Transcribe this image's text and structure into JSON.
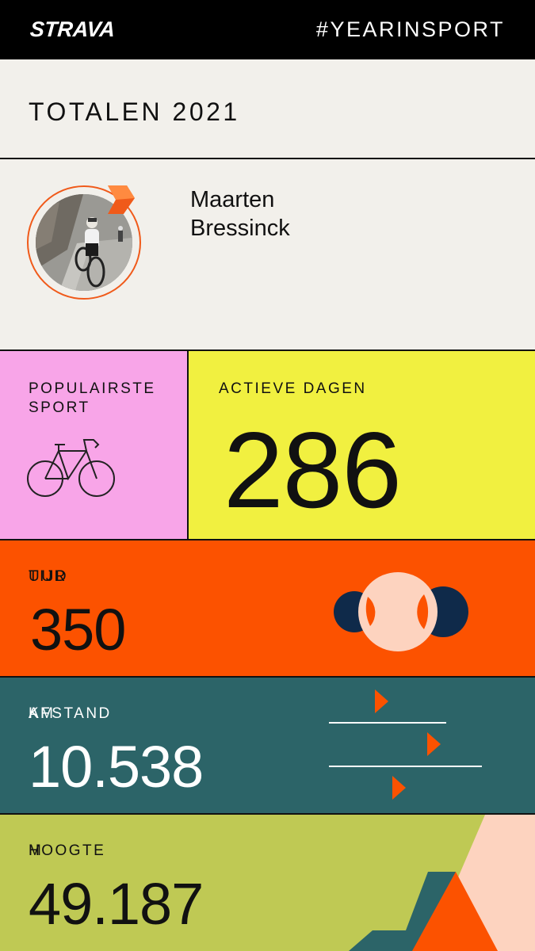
{
  "header": {
    "logo": "STRAVA",
    "hashtag": "#YEARINSPORT"
  },
  "title": "TOTALEN 2021",
  "profile": {
    "first_name": "Maarten",
    "last_name": "Bressinck"
  },
  "popular_sport": {
    "label_line1": "POPULAIRSTE",
    "label_line2": "SPORT",
    "icon": "road-bike-icon"
  },
  "active_days": {
    "label": "ACTIEVE DAGEN",
    "value": "286"
  },
  "time": {
    "label": "TIJD",
    "unit": "UUR",
    "value": "350"
  },
  "distance": {
    "label": "AFSTAND",
    "unit": "KM",
    "value": "10.538"
  },
  "elevation": {
    "label": "HOOGTE",
    "unit": "M",
    "value": "49.187"
  },
  "colors": {
    "header_bg": "#000000",
    "page_bg": "#f2f0eb",
    "sport_bg": "#f8a5e8",
    "days_bg": "#f1f040",
    "time_bg": "#fc5200",
    "distance_bg": "#2c6468",
    "elevation_bg": "#bfc954",
    "accent_orange": "#f05a1a",
    "navy": "#0f2a4a",
    "peach": "#fdd3bf"
  }
}
